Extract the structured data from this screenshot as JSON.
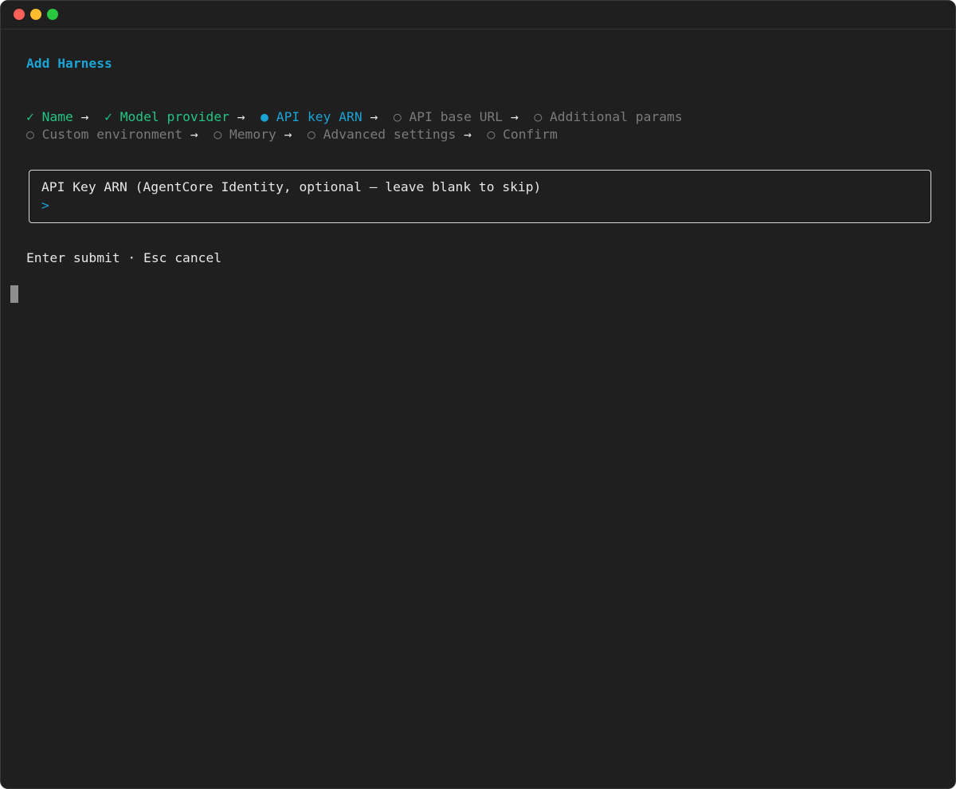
{
  "window": {
    "traffic_lights": [
      "close",
      "minimize",
      "maximize"
    ]
  },
  "header": {
    "title": "Add Harness"
  },
  "steps": {
    "check_glyph": "✓",
    "active_glyph": "●",
    "pending_glyph": "○",
    "arrow_glyph": "→",
    "items": [
      {
        "label": "Name",
        "state": "done"
      },
      {
        "label": "Model provider",
        "state": "done"
      },
      {
        "label": "API key ARN",
        "state": "active"
      },
      {
        "label": "API base URL",
        "state": "pending"
      },
      {
        "label": "Additional params",
        "state": "pending"
      },
      {
        "label": "Custom environment",
        "state": "pending"
      },
      {
        "label": "Memory",
        "state": "pending"
      },
      {
        "label": "Advanced settings",
        "state": "pending"
      },
      {
        "label": "Confirm",
        "state": "pending"
      }
    ]
  },
  "input_box": {
    "label": "API Key ARN (AgentCore Identity, optional — leave blank to skip)",
    "prompt": ">",
    "value": ""
  },
  "footer": {
    "hint": "Enter submit · Esc cancel"
  },
  "colors": {
    "background": "#1f1f1f",
    "accent": "#1aa3d4",
    "done": "#23c483",
    "pending": "#7a7a7a",
    "text": "#e6e6e6"
  }
}
